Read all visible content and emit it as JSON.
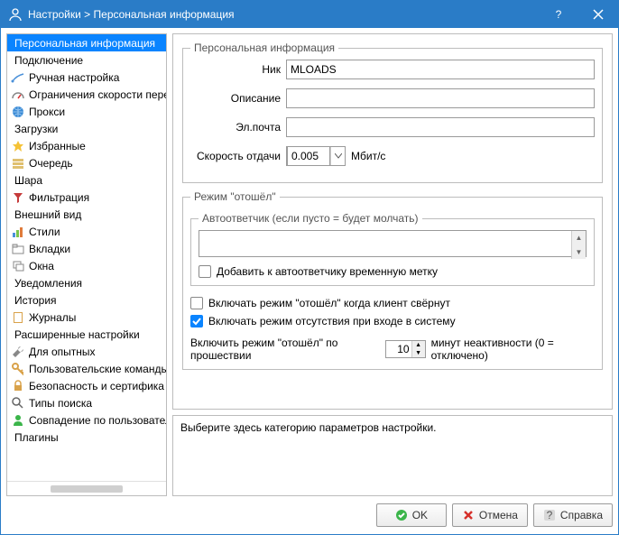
{
  "title": "Настройки > Персональная информация",
  "sidebar": {
    "items": [
      {
        "label": "Персональная информация",
        "icon": "none",
        "header": true,
        "selected": true
      },
      {
        "label": "Подключение",
        "icon": "none",
        "header": true
      },
      {
        "label": "Ручная настройка",
        "icon": "signal"
      },
      {
        "label": "Ограничения скорости пере",
        "icon": "gauge"
      },
      {
        "label": "Прокси",
        "icon": "globe"
      },
      {
        "label": "Загрузки",
        "icon": "none",
        "header": true
      },
      {
        "label": "Избранные",
        "icon": "star"
      },
      {
        "label": "Очередь",
        "icon": "queue"
      },
      {
        "label": "Шара",
        "icon": "none",
        "header": true
      },
      {
        "label": "Фильтрация",
        "icon": "filter"
      },
      {
        "label": "Внешний вид",
        "icon": "none",
        "header": true
      },
      {
        "label": "Стили",
        "icon": "chart"
      },
      {
        "label": "Вкладки",
        "icon": "tabs"
      },
      {
        "label": "Окна",
        "icon": "windows"
      },
      {
        "label": "Уведомления",
        "icon": "none",
        "header": true
      },
      {
        "label": "История",
        "icon": "none",
        "header": true
      },
      {
        "label": "Журналы",
        "icon": "book"
      },
      {
        "label": "Расширенные настройки",
        "icon": "none",
        "header": true
      },
      {
        "label": "Для опытных",
        "icon": "wrench"
      },
      {
        "label": "Пользовательские команды",
        "icon": "key"
      },
      {
        "label": "Безопасность и сертифика",
        "icon": "lock"
      },
      {
        "label": "Типы поиска",
        "icon": "search"
      },
      {
        "label": "Совпадение по пользовател",
        "icon": "user"
      },
      {
        "label": "Плагины",
        "icon": "none",
        "header": true
      }
    ]
  },
  "group": {
    "title": "Персональная информация",
    "nick_label": "Ник",
    "nick_value": "MLOADS",
    "desc_label": "Описание",
    "desc_value": "",
    "email_label": "Эл.почта",
    "email_value": "",
    "speed_label": "Скорость отдачи",
    "speed_value": "0.005",
    "speed_unit": "Мбит/с"
  },
  "away": {
    "title": "Режим \"отошёл\"",
    "responder_legend": "Автоответчик (если пусто = будет молчать)",
    "responder_value": "",
    "add_ts_label": "Добавить к автоответчику временную метку",
    "add_ts_checked": false,
    "cb_minimized_label": "Включать режим \"отошёл\" когда клиент свёрнут",
    "cb_minimized_checked": false,
    "cb_login_label": "Включать режим отсутствия при входе в систему",
    "cb_login_checked": true,
    "idle_prefix": "Включить режим \"отошёл\" по прошествии",
    "idle_value": "10",
    "idle_suffix": "минут неактивности (0 = отключено)"
  },
  "hint": "Выберите здесь категорию параметров настройки.",
  "buttons": {
    "ok": "OK",
    "cancel": "Отмена",
    "help": "Справка"
  }
}
